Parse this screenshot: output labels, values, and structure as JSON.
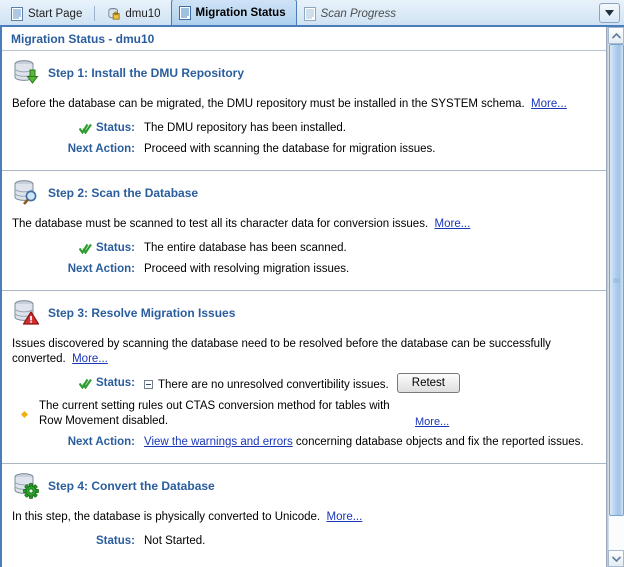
{
  "tabbar": {
    "tabs": [
      {
        "label": "Start Page",
        "icon": "document-icon",
        "active": false,
        "italic": false
      },
      {
        "label": "dmu10",
        "icon": "database-connection-icon",
        "active": false,
        "italic": false
      },
      {
        "label": "Migration Status",
        "icon": "document-icon",
        "active": true,
        "italic": false
      },
      {
        "label": "Scan Progress",
        "icon": "document-icon",
        "active": false,
        "italic": true
      }
    ],
    "dropdown_label": "chevron-down-icon"
  },
  "page": {
    "title": "Migration Status - dmu10"
  },
  "steps": [
    {
      "icon": "database-install-icon",
      "title": "Step 1: Install the DMU Repository",
      "description": "Before the database can be migrated, the DMU repository must be installed in the SYSTEM schema.",
      "more_label": "More...",
      "status_label": "Status:",
      "status_value": "The DMU repository has been installed.",
      "next_action_label": "Next Action:",
      "next_action_value": "Proceed with scanning the database for migration issues."
    },
    {
      "icon": "database-scan-icon",
      "title": "Step 2: Scan the Database",
      "description": "The database must be scanned to test all its character data for conversion issues.",
      "more_label": "More...",
      "status_label": "Status:",
      "status_value": "The entire database has been scanned.",
      "next_action_label": "Next Action:",
      "next_action_value": "Proceed with resolving migration issues."
    },
    {
      "icon": "database-warning-icon",
      "title": "Step 3: Resolve Migration Issues",
      "description": "Issues discovered by scanning the database need to be resolved before the database can be successfully converted.",
      "more_label": "More...",
      "status_label": "Status:",
      "status_value": "There are no unresolved convertibility issues.",
      "retest_label": "Retest",
      "warning_text": "The current setting rules out CTAS conversion method for tables with Row Movement disabled.",
      "warning_more_label": "More...",
      "next_action_label": "Next Action:",
      "next_action_link": "View the warnings and errors",
      "next_action_rest": " concerning database objects and fix the reported issues."
    },
    {
      "icon": "database-convert-icon",
      "title": "Step 4: Convert the Database",
      "description": "In this step, the database is physically converted to Unicode.",
      "more_label": "More...",
      "status_label": "Status:",
      "status_value": "Not Started."
    }
  ],
  "scrollbar": {
    "up_label": "scroll-up-icon",
    "down_label": "scroll-down-icon"
  },
  "colors": {
    "accent_blue": "#2a5d9e",
    "link_blue": "#1a36b8",
    "ok_green": "#2e9e32",
    "warning_amber": "#f0b010",
    "error_red": "#cc2222"
  }
}
